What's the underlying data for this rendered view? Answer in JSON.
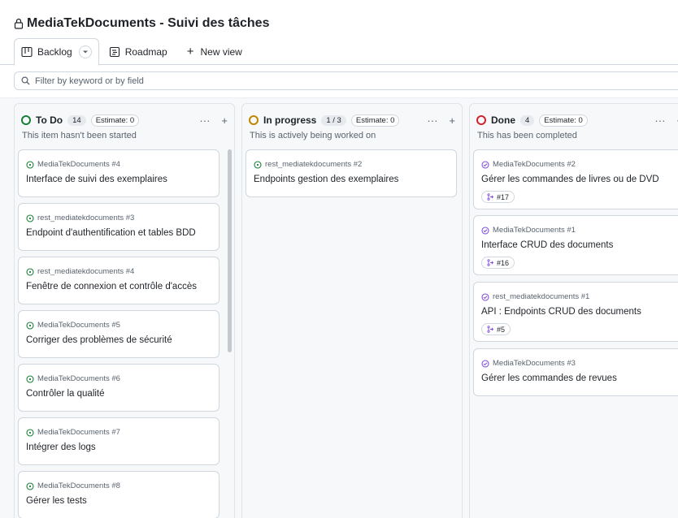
{
  "project": {
    "title": "MediaTekDocuments - Suivi des tâches"
  },
  "views": {
    "tabs": [
      {
        "label": "Backlog",
        "icon": "table-icon"
      },
      {
        "label": "Roadmap",
        "icon": "roadmap-icon"
      }
    ],
    "new_view_label": "New view"
  },
  "filter": {
    "placeholder": "Filter by keyword or by field"
  },
  "columns": [
    {
      "name": "To Do",
      "count": "14",
      "estimate": "Estimate: 0",
      "description": "This item hasn't been started",
      "color": "#1a7f37",
      "cards": [
        {
          "repo": "MediaTekDocuments #4",
          "title": "Interface de suivi des exemplaires"
        },
        {
          "repo": "rest_mediatekdocuments #3",
          "title": "Endpoint d'authentification et tables BDD"
        },
        {
          "repo": "rest_mediatekdocuments #4",
          "title": "Fenêtre de connexion et contrôle d'accès"
        },
        {
          "repo": "MediaTekDocuments #5",
          "title": "Corriger des problèmes de sécurité"
        },
        {
          "repo": "MediaTekDocuments #6",
          "title": "Contrôler la qualité"
        },
        {
          "repo": "MediaTekDocuments #7",
          "title": "Intégrer des logs"
        },
        {
          "repo": "MediaTekDocuments #8",
          "title": "Gérer les tests"
        }
      ]
    },
    {
      "name": "In progress",
      "count": "1 / 3",
      "estimate": "Estimate: 0",
      "description": "This is actively being worked on",
      "color": "#bf8700",
      "cards": [
        {
          "repo": "rest_mediatekdocuments #2",
          "title": "Endpoints gestion des exemplaires"
        }
      ]
    },
    {
      "name": "Done",
      "count": "4",
      "estimate": "Estimate: 0",
      "description": "This has been completed",
      "color": "#d1242f",
      "cards": [
        {
          "repo": "MediaTekDocuments #2",
          "title": "Gérer les commandes de livres ou de DVD",
          "pr": "#17"
        },
        {
          "repo": "MediaTekDocuments #1",
          "title": "Interface CRUD des documents",
          "pr": "#16"
        },
        {
          "repo": "rest_mediatekdocuments #1",
          "title": "API : Endpoints CRUD des documents",
          "pr": "#5"
        },
        {
          "repo": "MediaTekDocuments #3",
          "title": "Gérer les commandes de revues"
        }
      ]
    }
  ],
  "colors": {
    "open_issue": "#1a7f37",
    "closed_issue": "#8250df"
  }
}
